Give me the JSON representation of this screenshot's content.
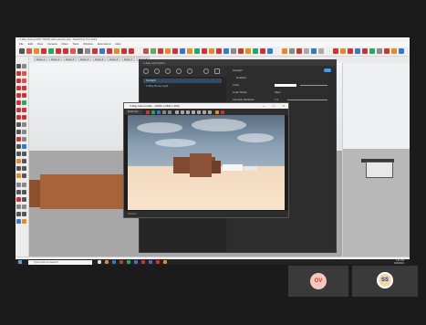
{
  "app": {
    "window_title": "V-Ray Scene OFF TRAIN with exterior.skp - SketchUp Pro 2019",
    "menu": [
      "File",
      "Edit",
      "View",
      "Camera",
      "Draw",
      "Tools",
      "Window",
      "Extensions",
      "Help"
    ],
    "scene_tabs": [
      "Scene 1",
      "Scene 2",
      "Scene 3",
      "Scene 4",
      "Scene 5",
      "Scene 6",
      "Scene 7",
      "Scene 8"
    ]
  },
  "light_editor": {
    "title": "V-Ray Light Editor",
    "items": [
      {
        "label": "Sunlight",
        "selected": true
      },
      {
        "label": "V-Ray Dome Light",
        "selected": false
      }
    ],
    "properties": {
      "header": "Sunlight",
      "enabled_label": "Enabled",
      "color_label": "Color",
      "color_mode_label": "Color Mode",
      "color_mode_value": "Filter",
      "intensity_label": "Intensity Multiplier",
      "intensity_value": "1.0"
    }
  },
  "frame_buffer": {
    "title": "V-Ray frame buffer - [100% of 800 x 450]",
    "channel": "RGB color",
    "status": "Finished"
  },
  "statusbar": {
    "hint": "Select objects. Shift to extend select. Drag mouse to select multiple.",
    "measurements_label": "Measurements"
  },
  "taskbar": {
    "search_placeholder": "Type here to search",
    "time": "1:21 PM",
    "date": "2/26/2021"
  },
  "call": {
    "participants": [
      {
        "initials": "OV",
        "color": "#f4c9bd"
      },
      {
        "initials": "SS",
        "color": "#eed9ad"
      }
    ]
  }
}
